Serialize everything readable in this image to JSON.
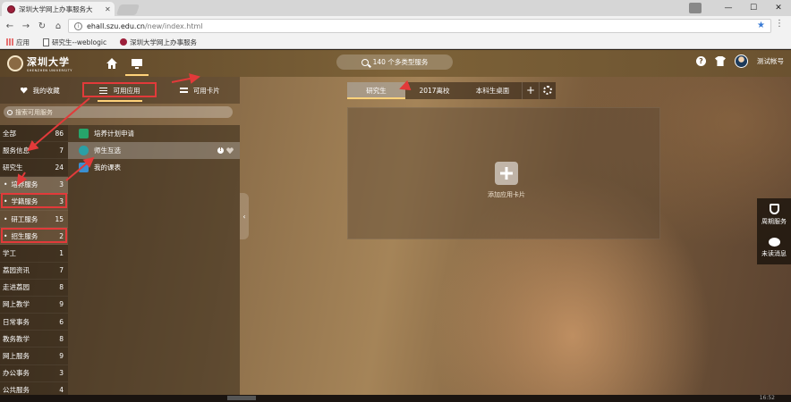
{
  "browser": {
    "tab_title": "深圳大学网上办事服务大",
    "url_host": "ehall.szu.edu.cn",
    "url_path": "/new/index.html",
    "window_controls": [
      "—",
      "☐",
      "✕"
    ],
    "bookmarks": [
      "应用",
      "研究生--weblogic",
      "深圳大学网上办事服务"
    ]
  },
  "header": {
    "logo_cn": "深圳大学",
    "logo_en": "SHENZHEN UNIVERSITY",
    "search_text": "140 个多类型服务",
    "help": "?",
    "username": "测试帐号"
  },
  "left": {
    "tabs": [
      "我的收藏",
      "可用应用",
      "可用卡片"
    ],
    "search_placeholder": "搜索可用服务",
    "categories": [
      {
        "name": "全部",
        "count": "86"
      },
      {
        "name": "服务信息",
        "count": "7"
      },
      {
        "name": "研究生",
        "count": "24"
      },
      {
        "name": "培养服务",
        "count": "3"
      },
      {
        "name": "学籍服务",
        "count": "3"
      },
      {
        "name": "研工服务",
        "count": "15"
      },
      {
        "name": "招生服务",
        "count": "2"
      },
      {
        "name": "学工",
        "count": "1"
      },
      {
        "name": "荔园资讯",
        "count": "7"
      },
      {
        "name": "走进荔园",
        "count": "8"
      },
      {
        "name": "网上教学",
        "count": "9"
      },
      {
        "name": "日常事务",
        "count": "6"
      },
      {
        "name": "教务教学",
        "count": "8"
      },
      {
        "name": "网上服务",
        "count": "9"
      },
      {
        "name": "办公事务",
        "count": "3"
      },
      {
        "name": "公共服务",
        "count": "4"
      }
    ],
    "apps": [
      "培养计划申请",
      "师生互选",
      "我的课表"
    ],
    "info_mark": "!"
  },
  "content": {
    "tabs": [
      "研究生",
      "2017离校",
      "本科生桌面"
    ],
    "add_tab": "+",
    "add_card_label": "添加应用卡片"
  },
  "side_widget": [
    "周期服务",
    "未读消息"
  ],
  "status_clock": "16:52"
}
